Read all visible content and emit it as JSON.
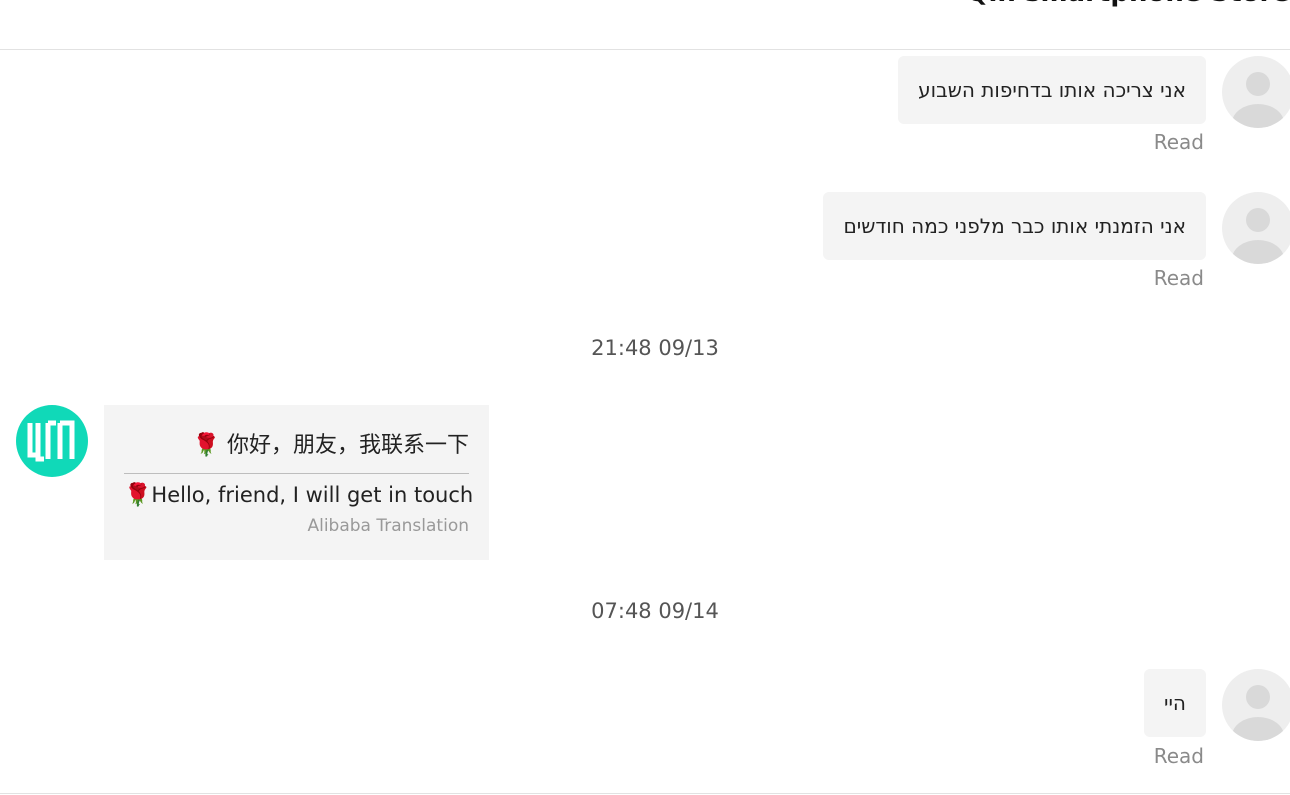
{
  "header": {
    "title": "Qin smartphone Store"
  },
  "messages": [
    {
      "text": "אני צריכה אותו בדחיפות השבוע",
      "status": "Read"
    },
    {
      "text": "אני הזמנתי אותו כבר מלפני כמה חודשים",
      "status": "Read"
    },
    {
      "text": "היי",
      "status": "Read"
    }
  ],
  "timestamps": [
    "21:48 09/13",
    "07:48 09/14"
  ],
  "incoming": {
    "original": "你好，朋友，我联系一下",
    "translated": "Hello, friend, I will get in touch",
    "source": "Alibaba Translation"
  },
  "colors": {
    "shop_avatar": "#10d9b8",
    "bubble": "#f4f4f4"
  },
  "icons": {
    "user_avatar": "default-user-avatar-icon",
    "shop_avatar": "qin-logo-icon",
    "emoji": "rose-emoji-icon"
  }
}
